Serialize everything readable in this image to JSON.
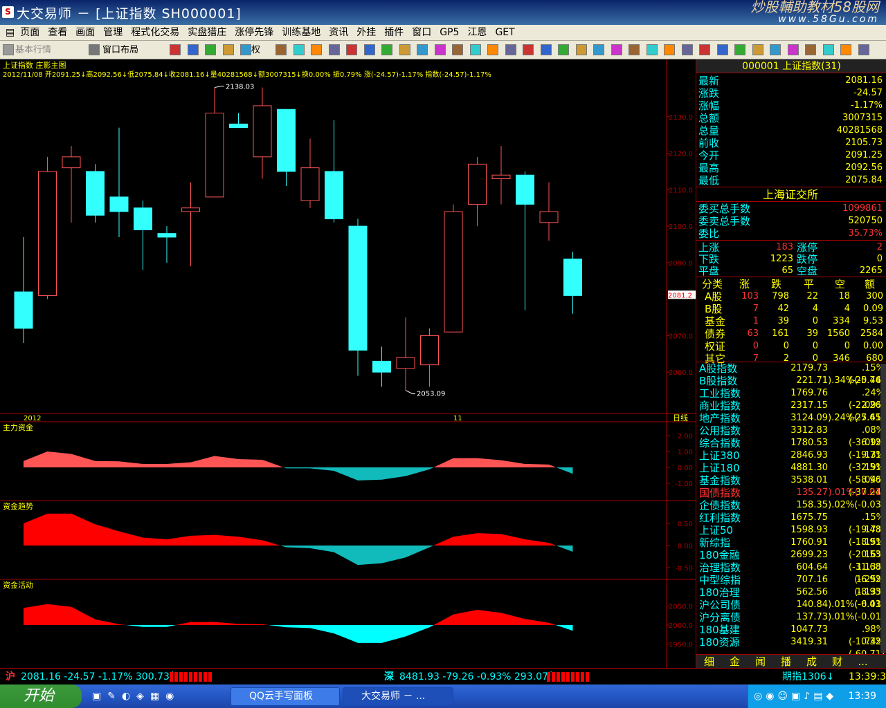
{
  "window": {
    "title": "大交易师 － [上证指数 SH000001]",
    "watermark_line1": "炒股輔助教材58股网",
    "watermark_line2": "www.58Gu.com"
  },
  "menu": [
    "页面",
    "查看",
    "画面",
    "管理",
    "程式化交易",
    "实盘猎庄",
    "涨停先锋",
    "训练基地",
    "资讯",
    "外挂",
    "插件",
    "窗口",
    "GP5",
    "江恩",
    "GET"
  ],
  "toolbar": {
    "btn1": "基本行情",
    "btn2": "窗口布局",
    "btn3": "权"
  },
  "chart": {
    "header": "上证指数 庄影主图",
    "info": "2012/11/08 开2091.25↓高2092.56↓低2075.84↓收2081.16↓量40281568↓额3007315↓换0.00% 振0.79% 涨(-24.57)-1.17% 指数(-24.57)-1.17%",
    "price_ticks": [
      "2130.0",
      "2120.0",
      "2110.0",
      "2100.0",
      "2090.0",
      "2070.0",
      "2060.0"
    ],
    "current_price": "2081.2",
    "high_label": "2138.03",
    "low_label": "2053.09",
    "date_left": "2012",
    "date_mid": "11",
    "period": "日线",
    "panel1_title": "主力资金",
    "panel1_ticks": [
      "2.00",
      "1.00",
      "0.00",
      "-1.00"
    ],
    "panel2_title": "资金趋势",
    "panel2_ticks": [
      "0.50",
      "0.00",
      "-0.50"
    ],
    "panel3_title": "资金活动",
    "panel3_ticks": [
      "2050.0",
      "2000.0",
      "1950.0"
    ]
  },
  "chart_data": {
    "type": "candlestick",
    "y_range": [
      2050,
      2140
    ],
    "candles": [
      {
        "o": 2082,
        "h": 2097,
        "l": 2068,
        "c": 2072
      },
      {
        "o": 2081,
        "h": 2119,
        "l": 2080,
        "c": 2115
      },
      {
        "o": 2116,
        "h": 2122,
        "l": 2101,
        "c": 2119
      },
      {
        "o": 2115,
        "h": 2117,
        "l": 2101,
        "c": 2103
      },
      {
        "o": 2108,
        "h": 2127,
        "l": 2097,
        "c": 2104
      },
      {
        "o": 2105,
        "h": 2107,
        "l": 2088,
        "c": 2099
      },
      {
        "o": 2098,
        "h": 2100,
        "l": 2090,
        "c": 2097
      },
      {
        "o": 2104,
        "h": 2112,
        "l": 2089,
        "c": 2105
      },
      {
        "o": 2108,
        "h": 2138,
        "l": 2108,
        "c": 2131
      },
      {
        "o": 2128,
        "h": 2131,
        "l": 2128,
        "c": 2127
      },
      {
        "o": 2119,
        "h": 2138,
        "l": 2113,
        "c": 2133
      },
      {
        "o": 2132,
        "h": 2132,
        "l": 2111,
        "c": 2115
      },
      {
        "o": 2107,
        "h": 2124,
        "l": 2105,
        "c": 2116
      },
      {
        "o": 2115,
        "h": 2129,
        "l": 2101,
        "c": 2102
      },
      {
        "o": 2100,
        "h": 2102,
        "l": 2059,
        "c": 2066
      },
      {
        "o": 2063,
        "h": 2067,
        "l": 2056,
        "c": 2060
      },
      {
        "o": 2061,
        "h": 2075,
        "l": 2055,
        "c": 2064
      },
      {
        "o": 2062,
        "h": 2072,
        "l": 2056,
        "c": 2070
      },
      {
        "o": 2071,
        "h": 2106,
        "l": 2071,
        "c": 2104
      },
      {
        "o": 2106,
        "h": 2119,
        "l": 2100,
        "c": 2117
      },
      {
        "o": 2113,
        "h": 2122,
        "l": 2106,
        "c": 2114
      },
      {
        "o": 2114,
        "h": 2115,
        "l": 2077,
        "c": 2106
      },
      {
        "o": 2101,
        "h": 2112,
        "l": 2096,
        "c": 2104
      },
      {
        "o": 2091,
        "h": 2093,
        "l": 2076,
        "c": 2081
      }
    ],
    "zhuli": [
      0.4,
      1.0,
      0.85,
      0.4,
      0.38,
      0.22,
      0.22,
      0.32,
      0.72,
      0.52,
      0.48,
      -0.06,
      -0.06,
      -0.22,
      -0.82,
      -0.77,
      -0.55,
      -0.12,
      0.58,
      0.58,
      0.45,
      0.22,
      0.18,
      -0.4
    ],
    "qushi": [
      0.5,
      0.72,
      0.72,
      0.48,
      0.32,
      0.18,
      0.14,
      0.22,
      0.24,
      0.2,
      0.12,
      -0.04,
      -0.06,
      -0.15,
      -0.44,
      -0.4,
      -0.27,
      -0.04,
      0.2,
      0.28,
      0.26,
      0.14,
      0.06,
      -0.14
    ],
    "huodong": [
      2045,
      2055,
      2048,
      2015,
      2002,
      1995,
      1995,
      2008,
      2008,
      2003,
      2002,
      1994,
      1992,
      1978,
      1953,
      1953,
      1970,
      1994,
      2028,
      2040,
      2032,
      2016,
      2006,
      1985
    ]
  },
  "quote": {
    "header": "000001 上证指数(31)",
    "rows": [
      {
        "label": "最新",
        "value": "2081.16"
      },
      {
        "label": "涨跌",
        "value": "-24.57"
      },
      {
        "label": "涨幅",
        "value": "-1.17%"
      },
      {
        "label": "总额",
        "value": "3007315"
      },
      {
        "label": "总量",
        "value": "40281568"
      },
      {
        "label": "前收",
        "value": "2105.73"
      },
      {
        "label": "今开",
        "value": "2091.25"
      },
      {
        "label": "最高",
        "value": "2092.56"
      },
      {
        "label": "最低",
        "value": "2075.84"
      }
    ],
    "exchange": "上海证交所",
    "ob": [
      {
        "label": "委买总手数",
        "value": "1099861",
        "color": "#f33"
      },
      {
        "label": "委卖总手数",
        "value": "520750",
        "color": "#ff0"
      },
      {
        "label": "委比",
        "value": "35.73%",
        "color": "#f33"
      }
    ],
    "breadth": [
      {
        "l1": "上涨",
        "v1": "183",
        "c1": "#f33",
        "l2": "涨停",
        "v2": "2",
        "c2": "#f33"
      },
      {
        "l1": "下跌",
        "v1": "1223",
        "c1": "#ff0",
        "l2": "跌停",
        "v2": "0",
        "c2": "#ff0"
      },
      {
        "l1": "平盘",
        "v1": "65",
        "c1": "#ff0",
        "l2": "空盘",
        "v2": "2265",
        "c2": "#ff0"
      }
    ],
    "cat_header": [
      "分类",
      "涨",
      "跌",
      "平",
      "空",
      "额"
    ],
    "cats": [
      {
        "n": "A股",
        "a": "103",
        "b": "798",
        "c": "22",
        "d": "18",
        "e": "300"
      },
      {
        "n": "B股",
        "a": "7",
        "b": "42",
        "c": "4",
        "d": "4",
        "e": "0.09"
      },
      {
        "n": "基金",
        "a": "1",
        "b": "39",
        "c": "0",
        "d": "334",
        "e": "9.53"
      },
      {
        "n": "债券",
        "a": "63",
        "b": "161",
        "c": "39",
        "d": "1560",
        "e": "2584"
      },
      {
        "n": "权证",
        "a": "0",
        "b": "0",
        "c": "0",
        "d": "0",
        "e": "0.00"
      },
      {
        "n": "其它",
        "a": "7",
        "b": "2",
        "c": "0",
        "d": "346",
        "e": "680"
      }
    ],
    "indices": [
      {
        "n": "A股指数",
        "a": "2179.73",
        "b": ".15%(-25.44)"
      },
      {
        "n": "B股指数",
        "a": "221.71",
        ".b": "",
        "b": ").34%(-0.76)"
      },
      {
        "n": "工业指数",
        "a": "1769.76",
        "b": ".24%(-22.26)"
      },
      {
        "n": "商业指数",
        "a": "2317.15",
        "b": ".09%(-25.61)"
      },
      {
        "n": "地产指数",
        "a": "3124.09",
        "b": ").24%(-7.45)"
      },
      {
        "n": "公用指数",
        "a": "3312.83",
        "b": ".08%(-36.12)"
      },
      {
        "n": "综合指数",
        "a": "1780.53",
        "b": ".09%(-19.71)"
      },
      {
        "n": "上证380",
        "a": "2846.93",
        "b": ".13%(-32.51)"
      },
      {
        "n": "上证180",
        "a": "4881.30",
        "b": ".19%(-58.96)"
      },
      {
        "n": "基金指数",
        "a": "3538.01",
        "b": ".04%(-37.24)"
      },
      {
        "n": "国债指数",
        "a": "135.27",
        "b": ").01%( 0.01)",
        "red": true
      },
      {
        "n": "企债指数",
        "a": "158.35",
        "b": ").02%(-0.03)"
      },
      {
        "n": "红利指数",
        "a": "1675.75",
        "b": ".15%(-19.48)"
      },
      {
        "n": "上证50",
        "a": "1598.93",
        "b": ".17%(-18.91)"
      },
      {
        "n": "新综指",
        "a": "1760.91",
        "b": ".15%(-20.53)"
      },
      {
        "n": "180金融",
        "a": "2699.23",
        "b": ".16%(-31.68)"
      },
      {
        "n": "治理指数",
        "a": "604.64",
        "b": "1.13%(-6.92)"
      },
      {
        "n": "中型综指",
        "a": "707.16",
        "b": "1.25%(-8.93)"
      },
      {
        "n": "180治理",
        "a": "562.56",
        "b": "1.13%(-6.43)"
      },
      {
        "n": "沪公司债",
        "a": "140.84",
        "b": ").01%(-0.01)"
      },
      {
        "n": "沪分离债",
        "a": "137.73",
        "b": ").01%(-0.01)"
      },
      {
        "n": "180基建",
        "a": "1047.73",
        "b": ".98%(-10.32)"
      },
      {
        "n": "180资源",
        "a": "3419.31",
        "b": ".74%(-60.71)"
      }
    ],
    "tabs": [
      "细",
      "金",
      "闻",
      "播",
      "成",
      "财",
      "..."
    ]
  },
  "status": {
    "sh_label": "沪",
    "sh": "2081.16 -24.57 -1.17% 300.73亿",
    "sz_label": "深",
    "sz": "8481.93 -79.26 -0.93% 293.07亿",
    "futures": "期指1306↓",
    "time": "13:39:3"
  },
  "taskbar": {
    "start": "开始",
    "task1": "QQ云手写面板",
    "task2": "大交易师 － ...",
    "clock": "13:39"
  }
}
